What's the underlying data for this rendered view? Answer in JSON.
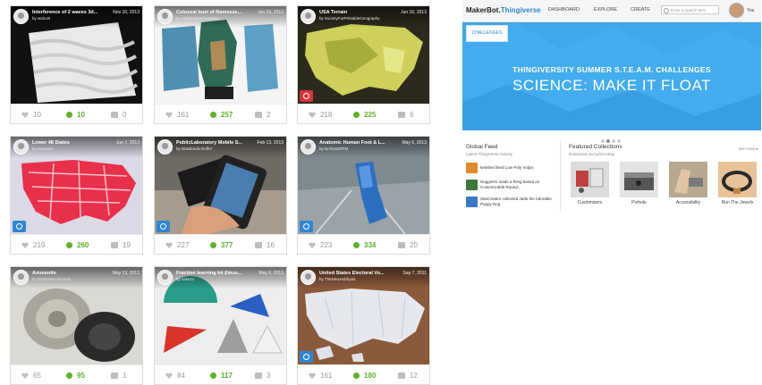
{
  "things": [
    {
      "title": "Interference of 2 waves 3d...",
      "date": "Nov 10, 2013",
      "author": "by walcott",
      "likes": "10",
      "makes": "10",
      "comments": "0",
      "badge": "none"
    },
    {
      "title": "Colossal bust of Ramesse...",
      "date": "Jun 15, 2013",
      "author": "by SMKMakerFreeware",
      "likes": "161",
      "makes": "257",
      "comments": "2",
      "badge": "none"
    },
    {
      "title": "USA Terrain",
      "date": "Jun 16, 2013",
      "author": "by SocietyForPrintableGeography",
      "likes": "218",
      "makes": "225",
      "comments": "6",
      "badge": "red"
    },
    {
      "title": "Lower 48 States",
      "date": "Jun 7, 2013",
      "author": "by aleander",
      "likes": "219",
      "makes": "260",
      "comments": "19",
      "badge": "blue"
    },
    {
      "title": "PublicLaboratory Mobile S...",
      "date": "Feb 13, 2013",
      "author": "by BradDudenhoffer",
      "likes": "227",
      "makes": "377",
      "comments": "16",
      "badge": "blue"
    },
    {
      "title": "Anatomic Human Foot & L...",
      "date": "May 6, 2013",
      "author": "by DrGlassDPM",
      "likes": "223",
      "makes": "334",
      "comments": "20",
      "badge": "blue"
    },
    {
      "title": "Ammonite",
      "date": "May 13, 2013",
      "author": "by BrittleStarVentures",
      "likes": "65",
      "makes": "95",
      "comments": "1",
      "badge": "none"
    },
    {
      "title": "Fraction learning kit (linus...",
      "date": "May 6, 2013",
      "author": "by luianzo",
      "likes": "84",
      "makes": "117",
      "comments": "3",
      "badge": "none"
    },
    {
      "title": "United States Electoral Vo...",
      "date": "Sep 7, 2011",
      "author": "by TheNewHobbyist",
      "likes": "161",
      "makes": "180",
      "comments": "12",
      "badge": "blue"
    }
  ],
  "site": {
    "logo_a": "MakerBot.",
    "logo_b": "Thingiverse",
    "nav": [
      "DASHBOARD",
      "EXPLORE",
      "CREATE"
    ],
    "search_placeholder": "Enter a search term",
    "user": "You"
  },
  "hero": {
    "tab": "CHALLENGES",
    "line1": "THINGIVERSITY SUMMER S.T.E.A.M. CHALLENGES",
    "line2": "SCIENCE: MAKE IT FLOAT",
    "slide_count": 4,
    "active_slide": 2
  },
  "global_feed": {
    "title": "Global Feed",
    "subtitle": "Latest Thingiverse Activity",
    "items": [
      {
        "text": "ketehen liked Low-Poly Vulpix",
        "color": "#e08a2c"
      },
      {
        "text": "Noggin01 made a thing based on Customizable Round...",
        "color": "#3a7a3a"
      },
      {
        "text": "StarCreator collected Jade the Adorable Puppy Dog",
        "color": "#3a78c8"
      }
    ]
  },
  "featured": {
    "title": "Featured Collections",
    "subtitle": "Download and print today",
    "more": "see more ▸",
    "items": [
      {
        "label": "Customizers"
      },
      {
        "label": "Pinhole"
      },
      {
        "label": "Accessibility"
      },
      {
        "label": "Run The Jewels"
      }
    ]
  }
}
